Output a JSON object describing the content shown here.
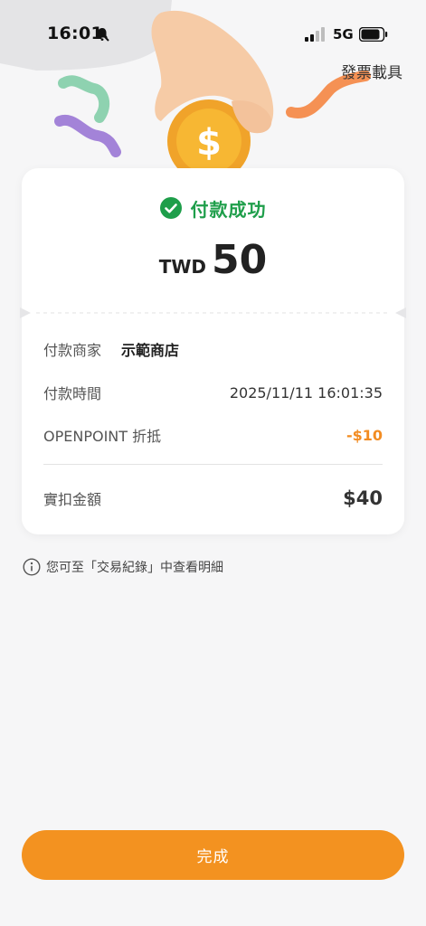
{
  "status_bar": {
    "time": "16:01",
    "network": "5G",
    "icons": [
      "bell-slash-icon",
      "signal-icon",
      "battery-icon"
    ]
  },
  "header": {
    "invoice_link": "發票載具"
  },
  "hero": {
    "illustration": [
      "hand-icon",
      "coin-icon",
      "confetti-icon"
    ]
  },
  "result": {
    "status": "付款成功",
    "currency": "TWD",
    "amount": "50"
  },
  "details": {
    "merchant_label": "付款商家",
    "merchant_value": "示範商店",
    "time_label": "付款時間",
    "time_value": "2025/11/11 16:01:35",
    "discount_label": "OPENPOINT 折抵",
    "discount_value": "-$10",
    "total_label": "實扣金額",
    "total_value": "$40"
  },
  "note": {
    "text": "您可至「交易紀錄」中查看明細"
  },
  "actions": {
    "done_label": "完成"
  },
  "colors": {
    "accent": "#f39220",
    "success": "#1e9e4a",
    "discount": "#f28c22",
    "background": "#f6f6f7"
  }
}
